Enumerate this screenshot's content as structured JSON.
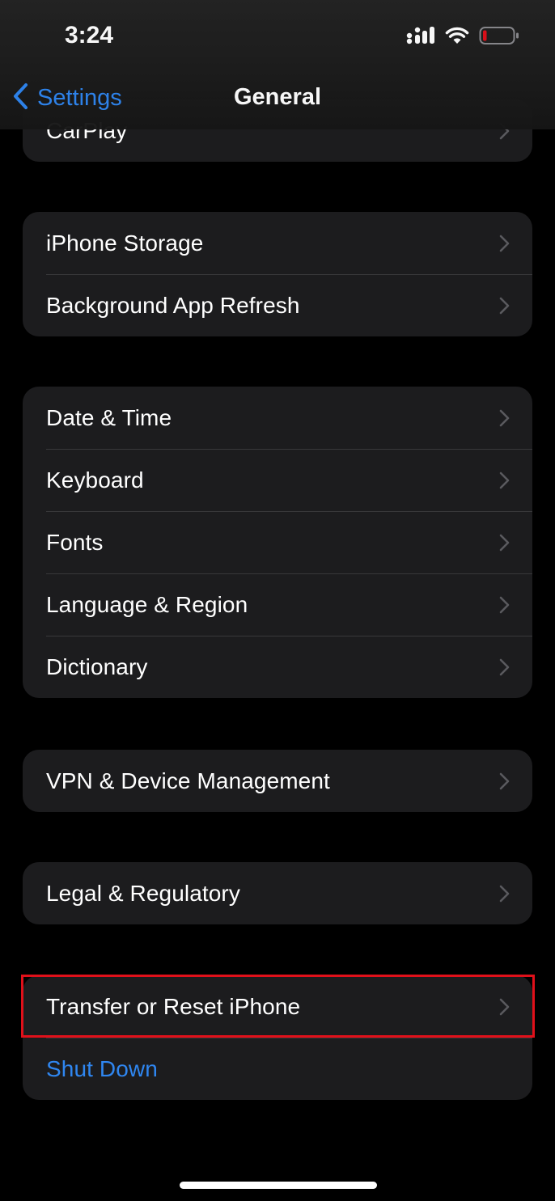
{
  "status_bar": {
    "time": "3:24",
    "icons": [
      "cellular-signal-icon",
      "wifi-icon",
      "battery-icon"
    ]
  },
  "nav": {
    "back_label": "Settings",
    "title": "General"
  },
  "groups": [
    {
      "items": [
        {
          "label": "CarPlay",
          "chevron": true
        }
      ]
    },
    {
      "items": [
        {
          "label": "iPhone Storage",
          "chevron": true
        },
        {
          "label": "Background App Refresh",
          "chevron": true
        }
      ]
    },
    {
      "items": [
        {
          "label": "Date & Time",
          "chevron": true
        },
        {
          "label": "Keyboard",
          "chevron": true
        },
        {
          "label": "Fonts",
          "chevron": true
        },
        {
          "label": "Language & Region",
          "chevron": true
        },
        {
          "label": "Dictionary",
          "chevron": true
        }
      ]
    },
    {
      "items": [
        {
          "label": "VPN & Device Management",
          "chevron": true
        }
      ]
    },
    {
      "items": [
        {
          "label": "Legal & Regulatory",
          "chevron": true
        }
      ]
    },
    {
      "items": [
        {
          "label": "Transfer or Reset iPhone",
          "chevron": true,
          "highlighted": true
        },
        {
          "label": "Shut Down",
          "chevron": false,
          "style": "link"
        }
      ]
    }
  ],
  "colors": {
    "background": "#000000",
    "cell": "#1c1c1e",
    "accent": "#2f86f0",
    "highlight_border": "#e0101a",
    "battery_low": "#e0101a"
  }
}
